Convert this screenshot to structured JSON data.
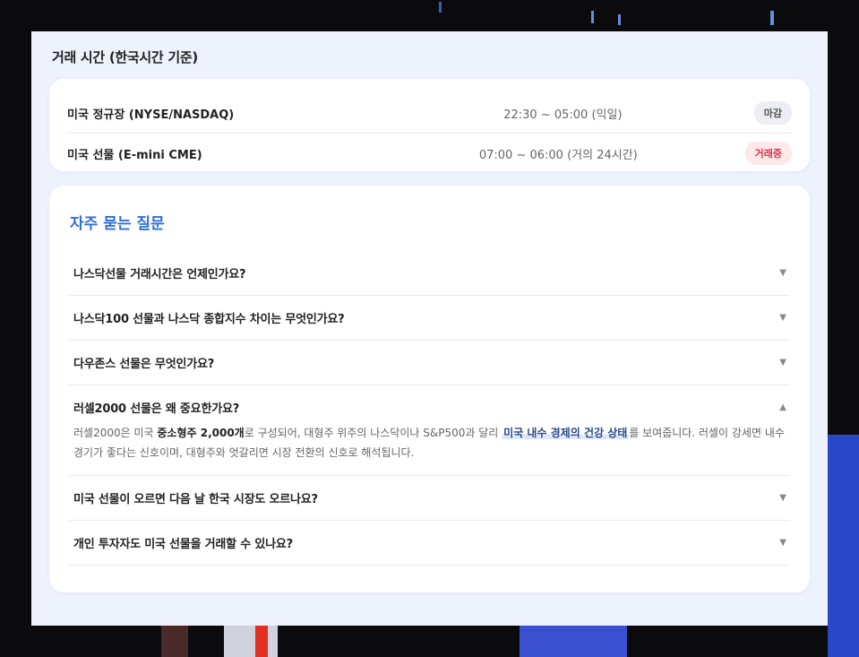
{
  "trading_hours": {
    "title": "거래 시간 (한국시간 기준)",
    "rows": [
      {
        "name": "미국 정규장 (NYSE/NASDAQ)",
        "time": "22:30 ~ 05:00 (익일)",
        "status": "마감"
      },
      {
        "name": "미국 선물 (E-mini CME)",
        "time": "07:00 ~ 06:00 (거의 24시간)",
        "status": "거래중"
      }
    ]
  },
  "faq": {
    "title": "자주 묻는 질문",
    "items": [
      {
        "question": "나스닥선물 거래시간은 언제인가요?"
      },
      {
        "question": "나스닥100 선물과 나스닥 종합지수 차이는 무엇인가요?"
      },
      {
        "question": "다우존스 선물은 무엇인가요?"
      },
      {
        "question": "러셀2000 선물은 왜 중요한가요?",
        "answer": {
          "part1": "러셀2000은 미국 ",
          "bold": "중소형주 2,000개",
          "part2": "로 구성되어, 대형주 위주의 나스닥이나 S&P500과 달리 ",
          "highlight": "미국 내수 경제의 건강 상태",
          "part3": "를 보여줍니다. 러셀이 강세면 내수 경기가 좋다는 신호이며, 대형주와 엇갈리면 시장 전환의 신호로 해석됩니다."
        }
      },
      {
        "question": "미국 선물이 오르면 다음 날 한국 시장도 오르나요?"
      },
      {
        "question": "개인 투자자도 미국 선물을 거래할 수 있나요?"
      }
    ],
    "collapsed_icon": "▼",
    "expanded_icon": "▲"
  },
  "colors": {
    "accent": "#2f6fd9",
    "open_badge": "#d9364a",
    "panel_bg": "#eef2fd"
  }
}
